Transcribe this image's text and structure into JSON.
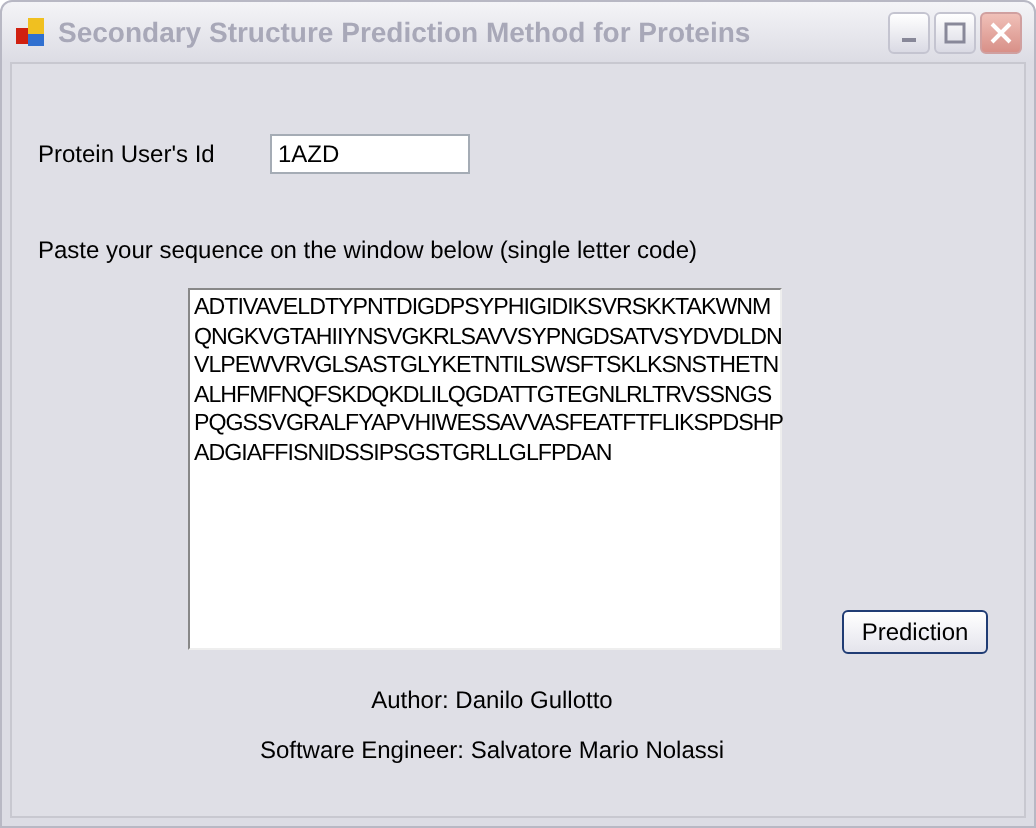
{
  "window": {
    "title": "Secondary Structure Prediction Method for Proteins"
  },
  "user_id": {
    "label": "Protein User's Id",
    "value": "1AZD"
  },
  "instruction": "Paste your sequence on the window below (single letter code)",
  "sequence": [
    "ADTIVAVELDTYPNTDIGDPSYPHIGIDIKSVRSKKTAKWNM",
    "QNGKVGTAHIIYNSVGKRLSAVVSYPNGDSATVSYDVDLDN",
    "VLPEWVRVGLSASTGLYKETNTILSWSFTSKLKSNSTHETN",
    "ALHFMFNQFSKDQKDLILQGDATTGTEGNLRLTRVSSNGS",
    "PQGSSVGRALFYAPVHIWESSAVVASFEATFTFLIKSPDSHP",
    "ADGIAFFISNIDSSIPSGSTGRLLGLFPDAN"
  ],
  "button": "Prediction",
  "credits": [
    "Author: Danilo Gullotto",
    "Software Engineer: Salvatore Mario Nolassi"
  ]
}
